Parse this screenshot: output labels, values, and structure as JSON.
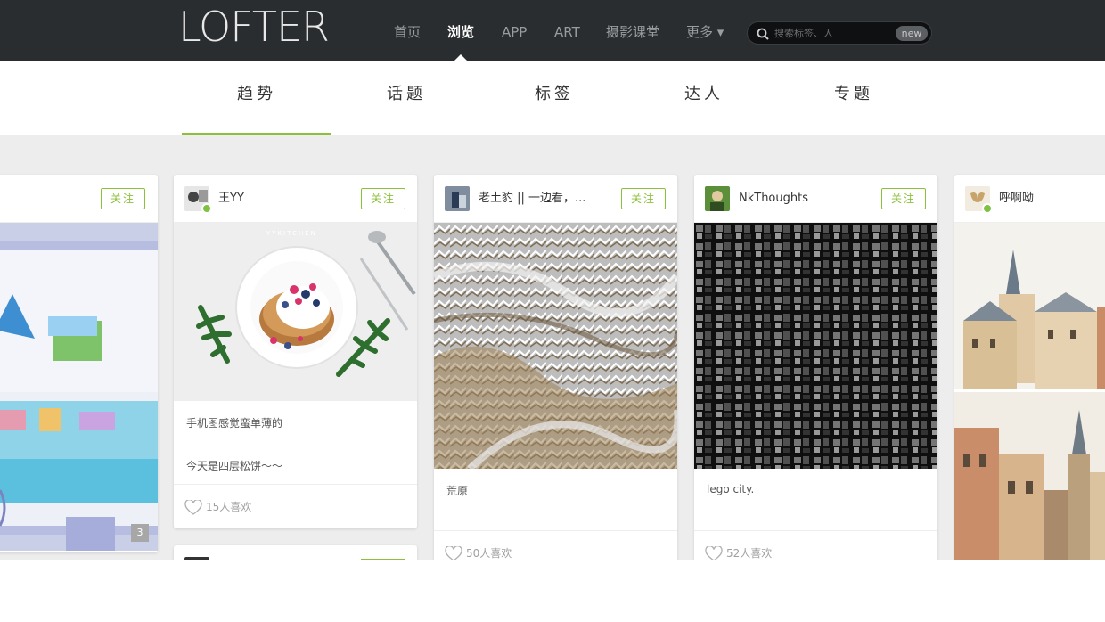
{
  "header": {
    "logo": "LOFTER",
    "nav": [
      {
        "label": "首页",
        "active": false
      },
      {
        "label": "浏览",
        "active": true
      },
      {
        "label": "APP",
        "active": false
      },
      {
        "label": "ART",
        "active": false
      },
      {
        "label": "摄影课堂",
        "active": false
      },
      {
        "label": "更多 ▾",
        "active": false
      }
    ],
    "search": {
      "placeholder": "搜索标签、人",
      "badge": "new"
    }
  },
  "subnav": {
    "tabs": [
      {
        "label": "趋势",
        "active": true
      },
      {
        "label": "话题",
        "active": false
      },
      {
        "label": "标签",
        "active": false
      },
      {
        "label": "达人",
        "active": false
      },
      {
        "label": "专题",
        "active": false
      }
    ],
    "accent": "#8cc03c"
  },
  "cards": [
    {
      "author": "",
      "follow": "关注",
      "image_count": "3"
    },
    {
      "author": "王YY",
      "follow": "关注",
      "image_caption": "YYKITCHEN",
      "text_1": "手机图感觉蛮单薄的",
      "text_2": "今天是四层松饼～～",
      "likes": "15人喜欢"
    },
    {
      "author": "老土豹 || 一边看，...",
      "follow": "关注",
      "text_1": "荒原",
      "likes": "50人喜欢"
    },
    {
      "author": "NkThoughts",
      "follow": "关注",
      "text_1": "lego city.",
      "likes": "52人喜欢"
    },
    {
      "author": "呼啊呦",
      "follow": ""
    }
  ],
  "colors": {
    "topbar": "#2a2d2f",
    "accent_green": "#8cc03c",
    "feed_bg": "#ededee"
  }
}
